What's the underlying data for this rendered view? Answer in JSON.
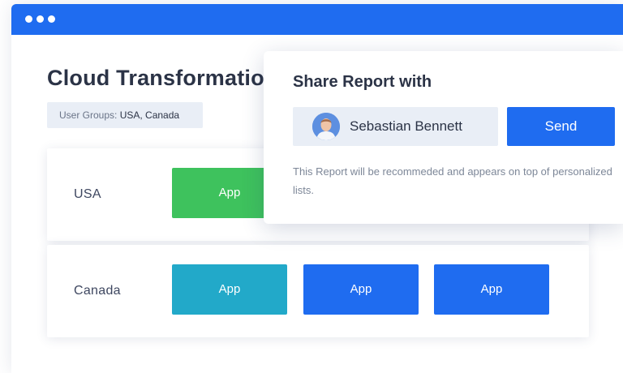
{
  "window": {
    "accent": "#1f6cf0"
  },
  "page": {
    "title": "Cloud Transformation",
    "user_groups_label": "User Groups: ",
    "user_groups_value": "USA, Canada"
  },
  "rows": [
    {
      "label": "USA",
      "apps": [
        {
          "label": "App",
          "color": "#3ec25d"
        }
      ]
    },
    {
      "label": "Canada",
      "apps": [
        {
          "label": "App",
          "color": "#22a9c9"
        },
        {
          "label": "App",
          "color": "#1f6cf0"
        },
        {
          "label": "App",
          "color": "#1f6cf0"
        }
      ]
    }
  ],
  "share_dialog": {
    "title": "Share Report with",
    "recipient_name": "Sebastian Bennett",
    "send_label": "Send",
    "note": "This Report will be recommeded and appears on top of personalized lists."
  },
  "icons": {
    "window_dots": "window-dot-icon",
    "avatar": "user-avatar"
  }
}
